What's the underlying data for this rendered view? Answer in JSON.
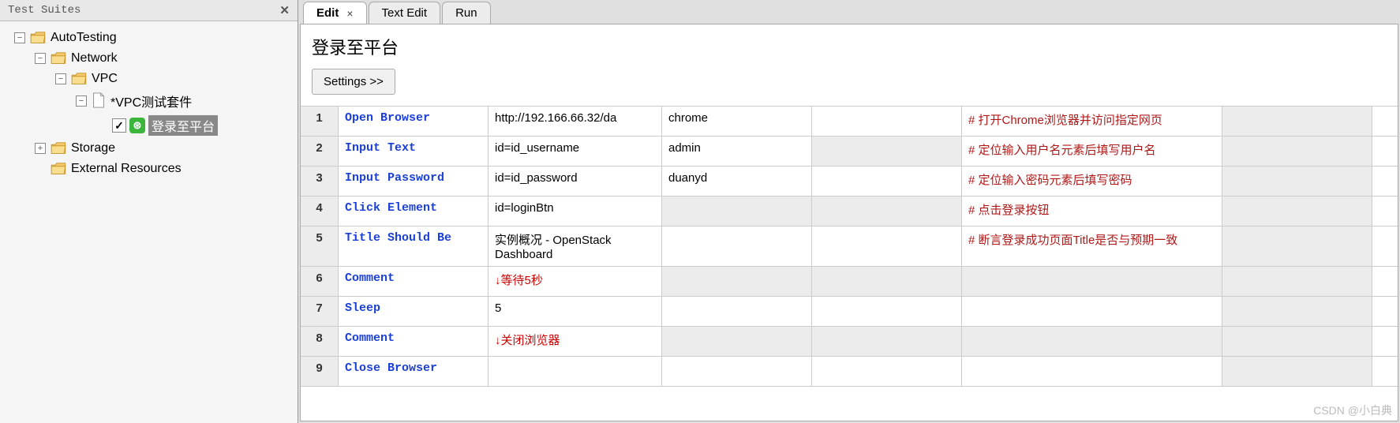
{
  "sidebar": {
    "title": "Test Suites",
    "tree": {
      "root": "AutoTesting",
      "network": "Network",
      "vpc": "VPC",
      "vpc_suite": "*VPC测试套件",
      "test_case": "登录至平台",
      "storage": "Storage",
      "external": "External Resources"
    }
  },
  "tabs": {
    "edit": "Edit",
    "text_edit": "Text Edit",
    "run": "Run"
  },
  "page": {
    "title": "登录至平台",
    "settings": "Settings >>"
  },
  "rows": [
    {
      "n": "1",
      "kw": "Open Browser",
      "a1": "http://192.166.66.32/da",
      "a2": "chrome",
      "a3": "",
      "cm": "#  打开Chrome浏览器并访问指定网页",
      "shaded": false
    },
    {
      "n": "2",
      "kw": "Input Text",
      "a1": "id=id_username",
      "a2": "admin",
      "a3": "",
      "cm": "#  定位输入用户名元素后填写用户名",
      "shaded": true
    },
    {
      "n": "3",
      "kw": "Input Password",
      "a1": "id=id_password",
      "a2": "duanyd",
      "a3": "",
      "cm": "#  定位输入密码元素后填写密码",
      "shaded": false
    },
    {
      "n": "4",
      "kw": "Click Element",
      "a1": "id=loginBtn",
      "a2": "",
      "a3": "",
      "cm": "#  点击登录按钮",
      "shaded": true
    },
    {
      "n": "5",
      "kw": "Title Should Be",
      "a1": "实例概况 - OpenStack Dashboard",
      "a2": "",
      "a3": "",
      "cm": "#  断言登录成功页面Title是否与预期一致",
      "shaded": false
    },
    {
      "n": "6",
      "kw": "Comment",
      "a1": "↓等待5秒",
      "a2": "",
      "a3": "",
      "cm": "",
      "shaded": true,
      "redArg": true
    },
    {
      "n": "7",
      "kw": "Sleep",
      "a1": "5",
      "a2": "",
      "a3": "",
      "cm": "",
      "shaded": false
    },
    {
      "n": "8",
      "kw": "Comment",
      "a1": "↓关闭浏览器",
      "a2": "",
      "a3": "",
      "cm": "",
      "shaded": true,
      "redArg": true
    },
    {
      "n": "9",
      "kw": "Close Browser",
      "a1": "",
      "a2": "",
      "a3": "",
      "cm": "",
      "shaded": false
    }
  ],
  "watermark": "CSDN @小白典"
}
